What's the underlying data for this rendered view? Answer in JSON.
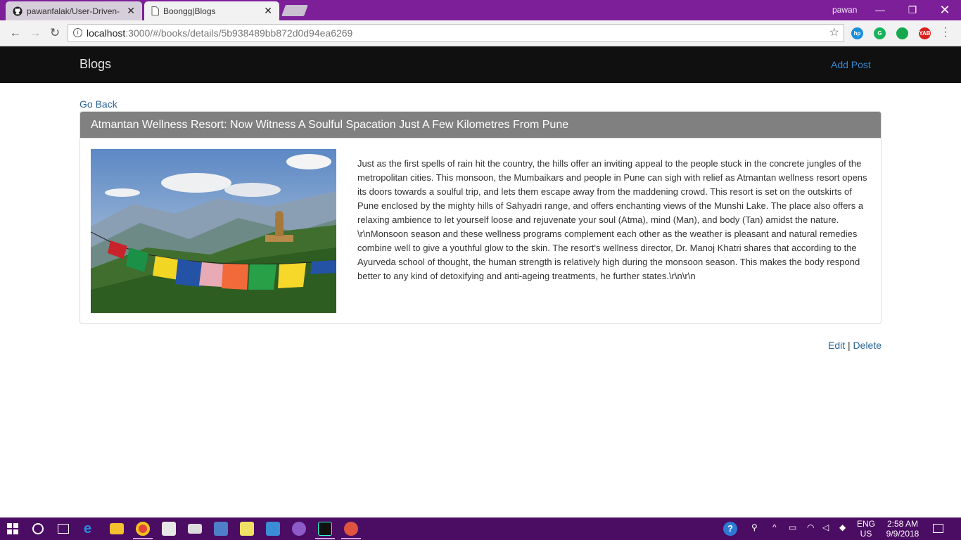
{
  "browser": {
    "tabs": [
      {
        "title": "pawanfalak/User-Driven-"
      },
      {
        "title": "Boongg|Blogs"
      }
    ],
    "profile_name": "pawan",
    "url_host": "localhost",
    "url_rest": ":3000/#/books/details/5b938489bb872d0d94ea6269"
  },
  "navbar": {
    "brand": "Blogs",
    "add_post": "Add Post"
  },
  "page": {
    "go_back": "Go Back",
    "post_title": "Atmantan Wellness Resort: Now Witness A Soulful Spacation Just A Few Kilometres From Pune",
    "post_body": "Just as the first spells of rain hit the country, the hills offer an inviting appeal to the people stuck in the concrete jungles of the metropolitan cities. This monsoon, the Mumbaikars and people in Pune can sigh with relief as Atmantan wellness resort opens its doors towards a soulful trip, and lets them escape away from the maddening crowd. This resort is set on the outskirts of Pune enclosed by the mighty hills of Sahyadri range, and offers enchanting views of the Munshi Lake. The place also offers a relaxing ambience to let yourself loose and rejuvenate your soul (Atma), mind (Man), and body (Tan) amidst the nature. \\r\\nMonsoon season and these wellness programs complement each other as the weather is pleasant and natural remedies combine well to give a youthful glow to the skin. The resort's wellness director, Dr. Manoj Khatri shares that according to the Ayurveda school of thought, the human strength is relatively high during the monsoon season. This makes the body respond better to any kind of detoxifying and anti-ageing treatments, he further states.\\r\\n\\r\\n",
    "edit": "Edit",
    "separator": "|",
    "delete": "Delete"
  },
  "taskbar": {
    "lang_line1": "ENG",
    "lang_line2": "US",
    "time": "2:58 AM",
    "date": "9/9/2018"
  }
}
